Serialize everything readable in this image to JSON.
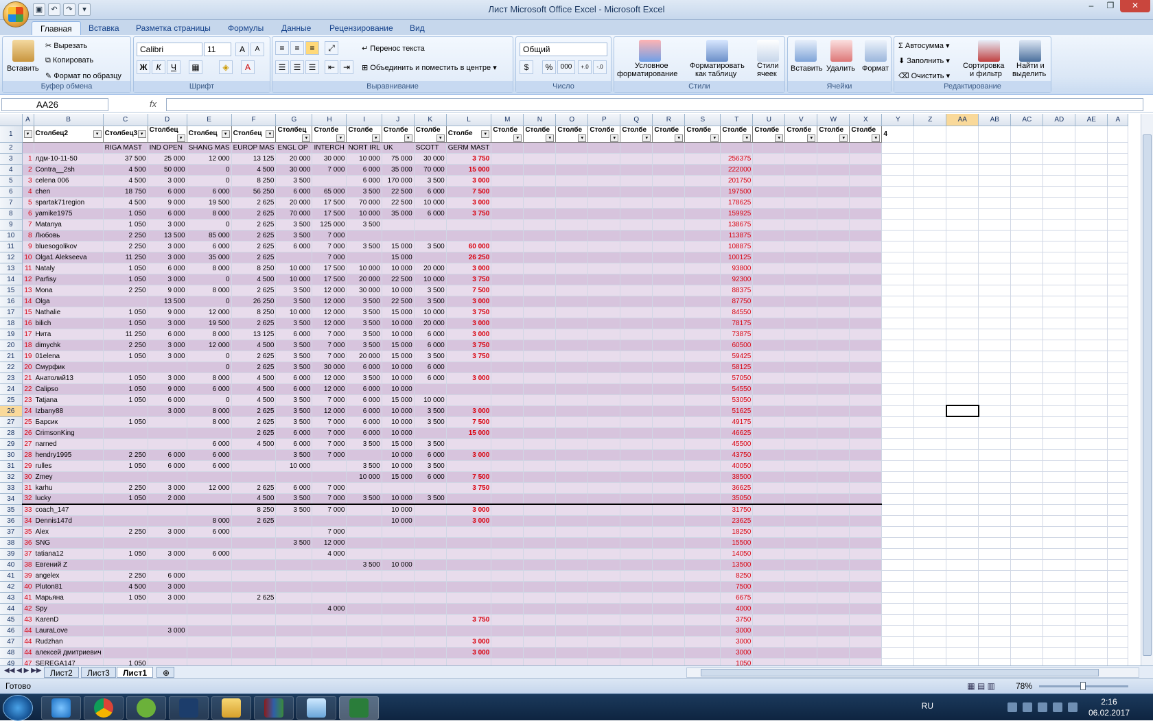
{
  "title": "Лист Microsoft Office Excel - Microsoft Excel",
  "qat": [
    "save",
    "undo",
    "redo",
    "customize"
  ],
  "tabs": [
    "Главная",
    "Вставка",
    "Разметка страницы",
    "Формулы",
    "Данные",
    "Рецензирование",
    "Вид"
  ],
  "ribbon": {
    "clipboard": {
      "paste": "Вставить",
      "cut": "Вырезать",
      "copy": "Копировать",
      "format_painter": "Формат по образцу",
      "label": "Буфер обмена"
    },
    "font": {
      "name": "Calibri",
      "size": "11",
      "label": "Шрифт",
      "bold": "Ж",
      "italic": "К",
      "underline": "Ч",
      "grow": "A",
      "shrink": "A"
    },
    "alignment": {
      "wrap": "Перенос текста",
      "merge": "Объединить и поместить в центре",
      "label": "Выравнивание"
    },
    "number": {
      "format": "Общий",
      "label": "Число",
      "percent": "%",
      "thousands": "000",
      "inc_dec": ",0 ,00",
      "dec_dec": ",00 ,0"
    },
    "styles": {
      "conditional": "Условное",
      "conditional2": "форматирование",
      "as_table": "Форматировать",
      "as_table2": "как таблицу",
      "cell_styles": "Стили",
      "cell_styles2": "ячеек",
      "label": "Стили"
    },
    "cells": {
      "insert": "Вставить",
      "delete": "Удалить",
      "format": "Формат",
      "label": "Ячейки"
    },
    "editing": {
      "autosum": "Автосумма",
      "fill": "Заполнить",
      "clear": "Очистить",
      "sort": "Сортировка",
      "sort2": "и фильтр",
      "find": "Найти и",
      "find2": "выделить",
      "label": "Редактирование"
    }
  },
  "formula": {
    "namebox": "AA26",
    "fx": "fx",
    "value": ""
  },
  "columns": [
    "A",
    "B",
    "C",
    "D",
    "E",
    "F",
    "G",
    "H",
    "I",
    "J",
    "K",
    "L",
    "M",
    "N",
    "O",
    "P",
    "Q",
    "R",
    "S",
    "T",
    "U",
    "V",
    "W",
    "X",
    "Y",
    "Z",
    "AA",
    "AB",
    "AC",
    "AD",
    "AE",
    "A"
  ],
  "header_row": [
    "",
    "Столбец2",
    "Столбец3",
    "Столбец",
    "Столбец",
    "Столбец",
    "Столбец",
    "Столбе",
    "Столбе",
    "Столбе",
    "Столбе",
    "Столбе",
    "Столбе",
    "Столбе",
    "Столбе",
    "Столбе",
    "Столбе",
    "Столбе",
    "Столбе",
    "Столбе",
    "Столбе",
    "Столбе",
    "Столбе",
    "Столбе",
    "4"
  ],
  "subheader": [
    "",
    "",
    "RIGA MAST",
    "IND OPEN",
    "SHANG MAS",
    "EUROP MAS",
    "ENGL OP",
    "INTERCH",
    "NORT IRL",
    "UK",
    "SCOTT",
    "GERM MAST"
  ],
  "rows": [
    [
      "1",
      "лдм-10-11-50",
      "37 500",
      "25 000",
      "12 000",
      "13 125",
      "20 000",
      "30 000",
      "10 000",
      "75 000",
      "30 000",
      "3 750",
      "256375"
    ],
    [
      "2",
      "Contra__2sh",
      "4 500",
      "50 000",
      "0",
      "4 500",
      "30 000",
      "7 000",
      "6 000",
      "35 000",
      "70 000",
      "15 000",
      "222000"
    ],
    [
      "3",
      "celena 006",
      "4 500",
      "3 000",
      "0",
      "8 250",
      "3 500",
      "",
      "6 000",
      "170 000",
      "3 500",
      "3 000",
      "201750"
    ],
    [
      "4",
      "chen",
      "18 750",
      "6 000",
      "6 000",
      "56 250",
      "6 000",
      "65 000",
      "3 500",
      "22 500",
      "6 000",
      "7 500",
      "197500"
    ],
    [
      "5",
      "spartak71region",
      "4 500",
      "9 000",
      "19 500",
      "2 625",
      "20 000",
      "17 500",
      "70 000",
      "22 500",
      "10 000",
      "3 000",
      "178625"
    ],
    [
      "6",
      "yamike1975",
      "1 050",
      "6 000",
      "8 000",
      "2 625",
      "70 000",
      "17 500",
      "10 000",
      "35 000",
      "6 000",
      "3 750",
      "159925"
    ],
    [
      "7",
      "Matanya",
      "1 050",
      "3 000",
      "0",
      "2 625",
      "3 500",
      "125 000",
      "3 500",
      "",
      "",
      "",
      "138675"
    ],
    [
      "8",
      "Любовь",
      "2 250",
      "13 500",
      "85 000",
      "2 625",
      "3 500",
      "7 000",
      "",
      "",
      "",
      "",
      "113875"
    ],
    [
      "9",
      "bluesogolikov",
      "2 250",
      "3 000",
      "6 000",
      "2 625",
      "6 000",
      "7 000",
      "3 500",
      "15 000",
      "3 500",
      "60 000",
      "108875"
    ],
    [
      "10",
      "Olga1 Alekseeva",
      "11 250",
      "3 000",
      "35 000",
      "2 625",
      "",
      "7 000",
      "",
      "15 000",
      "",
      "26 250",
      "100125"
    ],
    [
      "11",
      "Nataly",
      "1 050",
      "6 000",
      "8 000",
      "8 250",
      "10 000",
      "17 500",
      "10 000",
      "10 000",
      "20 000",
      "3 000",
      "93800"
    ],
    [
      "12",
      "Parfisy",
      "1 050",
      "3 000",
      "0",
      "4 500",
      "10 000",
      "17 500",
      "20 000",
      "22 500",
      "10 000",
      "3 750",
      "92300"
    ],
    [
      "13",
      "Mona",
      "2 250",
      "9 000",
      "8 000",
      "2 625",
      "3 500",
      "12 000",
      "30 000",
      "10 000",
      "3 500",
      "7 500",
      "88375"
    ],
    [
      "14",
      "Olga",
      "",
      "13 500",
      "0",
      "26 250",
      "3 500",
      "12 000",
      "3 500",
      "22 500",
      "3 500",
      "3 000",
      "87750"
    ],
    [
      "15",
      "Nathalie",
      "1 050",
      "9 000",
      "12 000",
      "8 250",
      "10 000",
      "12 000",
      "3 500",
      "15 000",
      "10 000",
      "3 750",
      "84550"
    ],
    [
      "16",
      "bilich",
      "1 050",
      "3 000",
      "19 500",
      "2 625",
      "3 500",
      "12 000",
      "3 500",
      "10 000",
      "20 000",
      "3 000",
      "78175"
    ],
    [
      "17",
      "Нита",
      "11 250",
      "6 000",
      "8 000",
      "13 125",
      "6 000",
      "7 000",
      "3 500",
      "10 000",
      "6 000",
      "3 000",
      "73875"
    ],
    [
      "18",
      "dimychk",
      "2 250",
      "3 000",
      "12 000",
      "4 500",
      "3 500",
      "7 000",
      "3 500",
      "15 000",
      "6 000",
      "3 750",
      "60500"
    ],
    [
      "19",
      "01elena",
      "1 050",
      "3 000",
      "0",
      "2 625",
      "3 500",
      "7 000",
      "20 000",
      "15 000",
      "3 500",
      "3 750",
      "59425"
    ],
    [
      "20",
      "Смурфик",
      "",
      "",
      "0",
      "2 625",
      "3 500",
      "30 000",
      "6 000",
      "10 000",
      "6 000",
      "",
      "58125"
    ],
    [
      "21",
      "Анатолий13",
      "1 050",
      "3 000",
      "8 000",
      "4 500",
      "6 000",
      "12 000",
      "3 500",
      "10 000",
      "6 000",
      "3 000",
      "57050"
    ],
    [
      "22",
      "Calipso",
      "1 050",
      "9 000",
      "6 000",
      "4 500",
      "6 000",
      "12 000",
      "6 000",
      "10 000",
      "",
      "",
      "54550"
    ],
    [
      "23",
      "Tatjana",
      "1 050",
      "6 000",
      "0",
      "4 500",
      "3 500",
      "7 000",
      "6 000",
      "15 000",
      "10 000",
      "",
      "53050"
    ],
    [
      "24",
      "Izbany88",
      "",
      "3 000",
      "8 000",
      "2 625",
      "3 500",
      "12 000",
      "6 000",
      "10 000",
      "3 500",
      "3 000",
      "51625"
    ],
    [
      "25",
      "Барсик",
      "1 050",
      "",
      "8 000",
      "2 625",
      "3 500",
      "7 000",
      "6 000",
      "10 000",
      "3 500",
      "7 500",
      "49175"
    ],
    [
      "26",
      "CrimsonKing",
      "",
      "",
      "",
      "2 625",
      "6 000",
      "7 000",
      "6 000",
      "10 000",
      "",
      "15 000",
      "46625"
    ],
    [
      "27",
      "narned",
      "",
      "",
      "6 000",
      "4 500",
      "6 000",
      "7 000",
      "3 500",
      "15 000",
      "3 500",
      "",
      "45500"
    ],
    [
      "28",
      "hendry1995",
      "2 250",
      "6 000",
      "6 000",
      "",
      "3 500",
      "7 000",
      "",
      "10 000",
      "6 000",
      "3 000",
      "43750"
    ],
    [
      "29",
      "rulles",
      "1 050",
      "6 000",
      "6 000",
      "",
      "10 000",
      "",
      "3 500",
      "10 000",
      "3 500",
      "",
      "40050"
    ],
    [
      "30",
      "Zmey",
      "",
      "",
      "",
      "",
      "",
      "",
      "10 000",
      "15 000",
      "6 000",
      "7 500",
      "38500"
    ],
    [
      "31",
      "karhu",
      "2 250",
      "3 000",
      "12 000",
      "2 625",
      "6 000",
      "7 000",
      "",
      "",
      "",
      "3 750",
      "36625"
    ],
    [
      "32",
      "lucky",
      "1 050",
      "2 000",
      "",
      "4 500",
      "3 500",
      "7 000",
      "3 500",
      "10 000",
      "3 500",
      "",
      "35050"
    ],
    [
      "33",
      "coach_147",
      "",
      "",
      "",
      "8 250",
      "3 500",
      "7 000",
      "",
      "10 000",
      "",
      "3 000",
      "31750"
    ],
    [
      "34",
      "Dennis147d",
      "",
      "",
      "8 000",
      "2 625",
      "",
      "",
      "",
      "10 000",
      "",
      "3 000",
      "23625"
    ],
    [
      "35",
      "Alex",
      "2 250",
      "3 000",
      "6 000",
      "",
      "",
      "7 000",
      "",
      "",
      "",
      "",
      "18250"
    ],
    [
      "36",
      "SNG",
      "",
      "",
      "",
      "",
      "3 500",
      "12 000",
      "",
      "",
      "",
      "",
      "15500"
    ],
    [
      "37",
      "tatiana12",
      "1 050",
      "3 000",
      "6 000",
      "",
      "",
      "4 000",
      "",
      "",
      "",
      "",
      "14050"
    ],
    [
      "38",
      "Евгений Z",
      "",
      "",
      "",
      "",
      "",
      "",
      "3 500",
      "10 000",
      "",
      "",
      "13500"
    ],
    [
      "39",
      "angelex",
      "2 250",
      "6 000",
      "",
      "",
      "",
      "",
      "",
      "",
      "",
      "",
      "8250"
    ],
    [
      "40",
      "Pluton81",
      "4 500",
      "3 000",
      "",
      "",
      "",
      "",
      "",
      "",
      "",
      "",
      "7500"
    ],
    [
      "41",
      "Марьяна",
      "1 050",
      "3 000",
      "",
      "2 625",
      "",
      "",
      "",
      "",
      "",
      "",
      "6675"
    ],
    [
      "42",
      "Spy",
      "",
      "",
      "",
      "",
      "",
      "4 000",
      "",
      "",
      "",
      "",
      "4000"
    ],
    [
      "43",
      "KarenD",
      "",
      "",
      "",
      "",
      "",
      "",
      "",
      "",
      "",
      "3 750",
      "3750"
    ],
    [
      "44",
      "LauraLove",
      "",
      "3 000",
      "",
      "",
      "",
      "",
      "",
      "",
      "",
      "",
      "3000"
    ],
    [
      "44",
      "Rudzhan",
      "",
      "",
      "",
      "",
      "",
      "",
      "",
      "",
      "",
      "3 000",
      "3000"
    ],
    [
      "44",
      "алексей дмитриевич",
      "",
      "",
      "",
      "",
      "",
      "",
      "",
      "",
      "",
      "3 000",
      "3000"
    ],
    [
      "47",
      "SEREGA147",
      "1 050",
      "",
      "",
      "",
      "",
      "",
      "",
      "",
      "",
      "",
      "1050"
    ]
  ],
  "sheets": [
    "Лист2",
    "Лист3",
    "Лист1"
  ],
  "status": {
    "ready": "Готово",
    "zoom": "78%"
  },
  "tray": {
    "lang": "RU",
    "time": "2:16",
    "date": "06.02.2017"
  },
  "colors": {
    "band_light": "#e8dcec",
    "band_dark": "#d7c4dd",
    "red": "#d9000d",
    "ribbon": "#dbe7f6"
  }
}
